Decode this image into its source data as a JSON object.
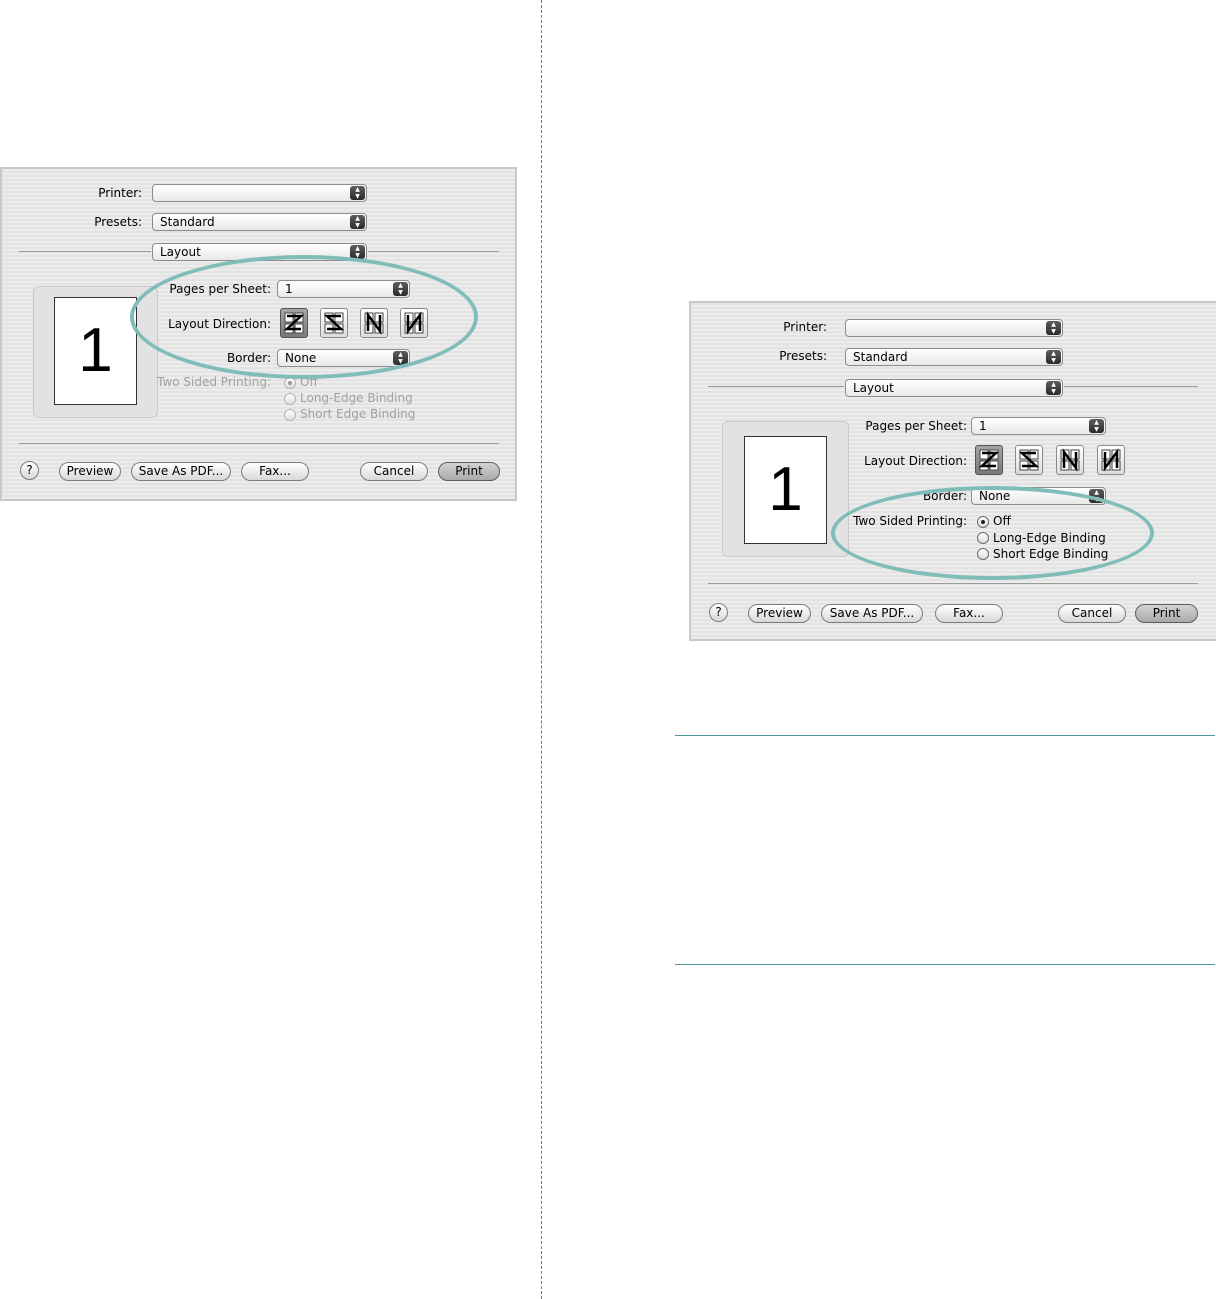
{
  "dialogs": [
    {
      "printer_label": "Printer:",
      "printer_value": "",
      "presets_label": "Presets:",
      "presets_value": "Standard",
      "panel_value": "Layout",
      "pages_per_sheet_label": "Pages per Sheet:",
      "pages_per_sheet_value": "1",
      "layout_direction_label": "Layout Direction:",
      "border_label": "Border:",
      "border_value": "None",
      "two_sided_label": "Two Sided Printing:",
      "two_sided_options": [
        "Off",
        "Long-Edge Binding",
        "Short Edge Binding"
      ],
      "two_sided_selected": "Off",
      "two_sided_enabled": false,
      "preview_page_number": "1",
      "buttons": {
        "help": "?",
        "preview": "Preview",
        "save_pdf": "Save As PDF...",
        "fax": "Fax...",
        "cancel": "Cancel",
        "print": "Print"
      },
      "highlight": "pages-per-sheet-and-layout-direction"
    },
    {
      "printer_label": "Printer:",
      "printer_value": "",
      "presets_label": "Presets:",
      "presets_value": "Standard",
      "panel_value": "Layout",
      "pages_per_sheet_label": "Pages per Sheet:",
      "pages_per_sheet_value": "1",
      "layout_direction_label": "Layout Direction:",
      "border_label": "Border:",
      "border_value": "None",
      "two_sided_label": "Two Sided Printing:",
      "two_sided_options": [
        "Off",
        "Long-Edge Binding",
        "Short Edge Binding"
      ],
      "two_sided_selected": "Off",
      "two_sided_enabled": true,
      "preview_page_number": "1",
      "buttons": {
        "help": "?",
        "preview": "Preview",
        "save_pdf": "Save As PDF...",
        "fax": "Fax...",
        "cancel": "Cancel",
        "print": "Print"
      },
      "highlight": "two-sided-printing"
    }
  ],
  "layout_direction_icons": [
    "z-direction-icon",
    "reverse-z-direction-icon",
    "n-reverse-direction-icon",
    "n-direction-icon"
  ],
  "colors": {
    "highlight": "#80bdb9",
    "rule": "#4f9796",
    "dialog_bg": "#e8e8e8"
  }
}
